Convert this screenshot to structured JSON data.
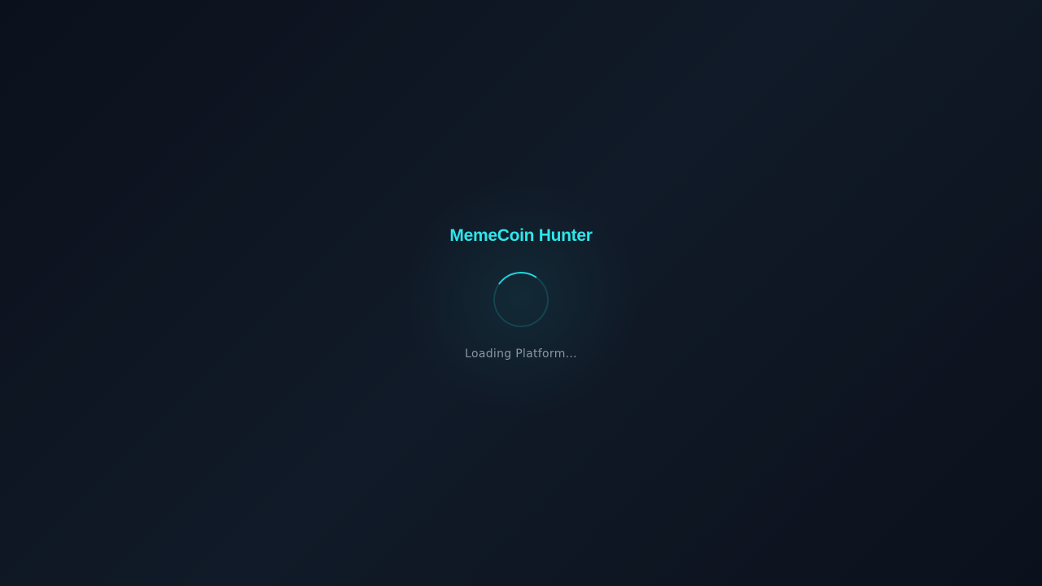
{
  "app": {
    "title": "MemeCoin Hunter"
  },
  "loader": {
    "status_text": "Loading Platform...",
    "spinner_icon": "spinner-icon"
  },
  "colors": {
    "accent": "#2ee6ea",
    "background": "#0f1623",
    "status_text": "#8a94a6"
  }
}
